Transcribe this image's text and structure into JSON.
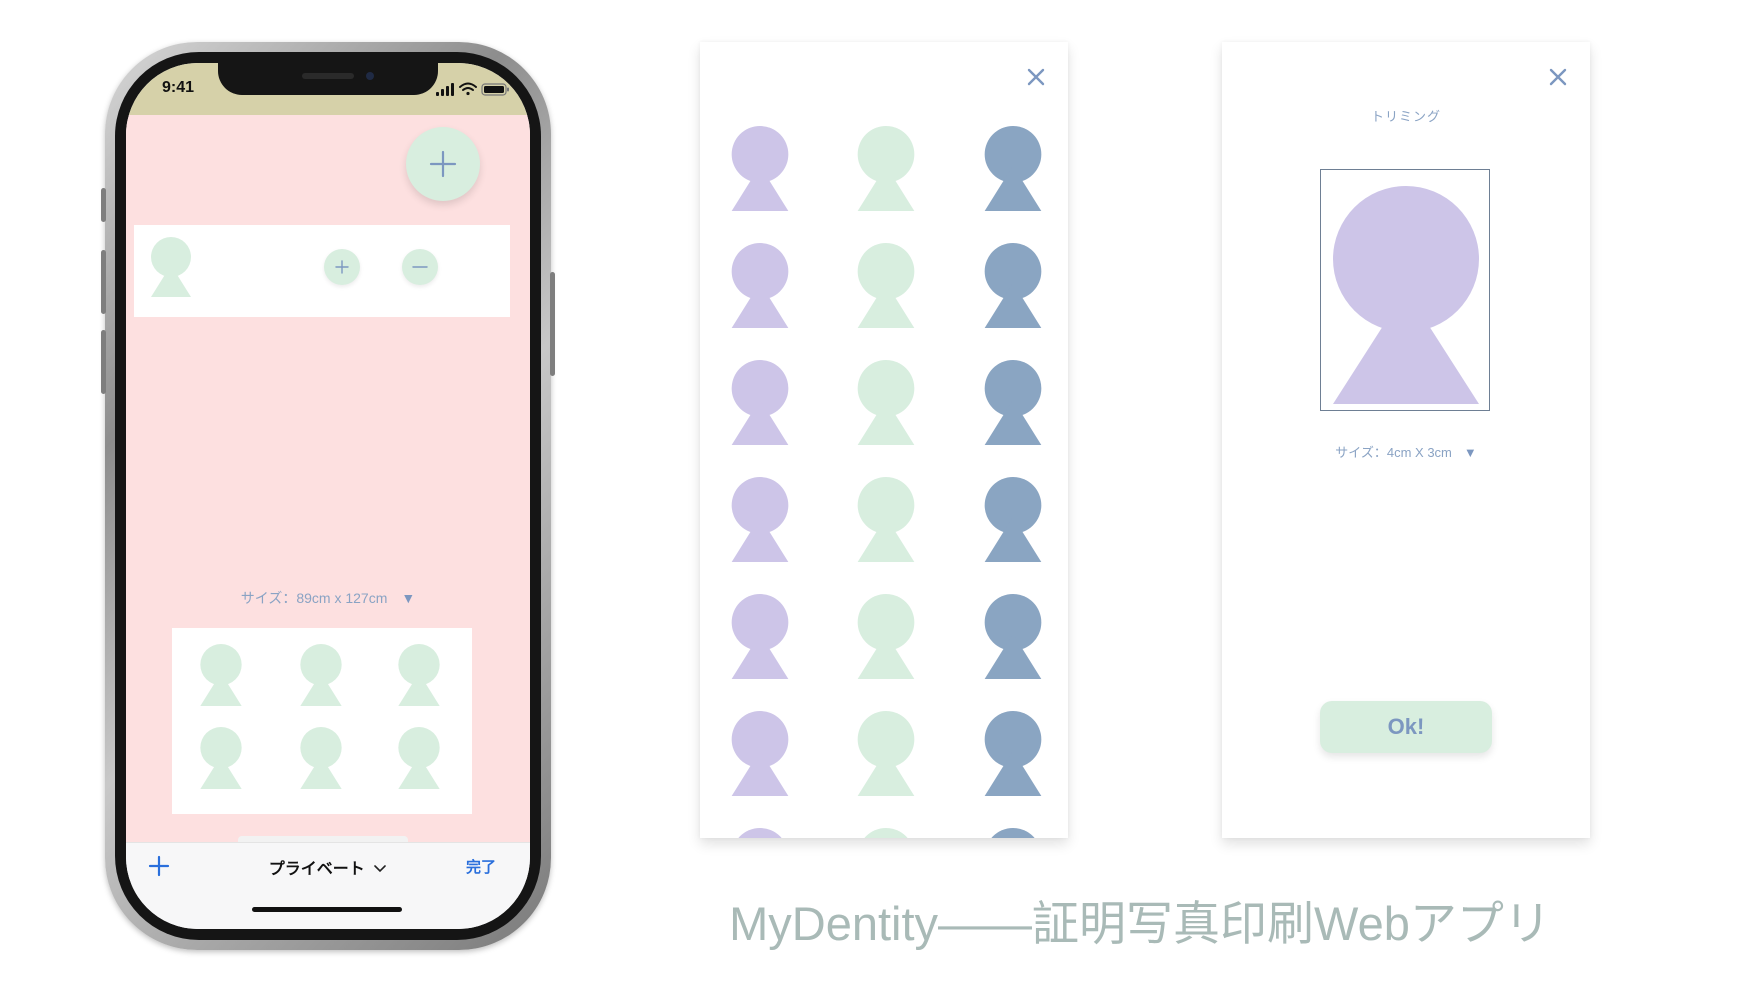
{
  "phone": {
    "status_time": "9:41",
    "order_count": "6",
    "print_size_label": "サイズ：89cm x 127cm",
    "size_dropdown_icon": "▼",
    "tab_bar": {
      "add_icon": "plus-icon",
      "title": "プライベート",
      "title_chevron": "chevron-down-icon",
      "done_label": "完了"
    },
    "preview_photo_count": 6
  },
  "photo_picker": {
    "close_icon": "close-icon",
    "rows_visible": 6,
    "column_colors": [
      "#cdc5e8",
      "#d8eedf",
      "#8aa5c2"
    ]
  },
  "trimming": {
    "close_icon": "close-icon",
    "title": "トリミング",
    "size_label": "サイズ：4cm X 3cm",
    "size_dropdown_icon": "▼",
    "ok_label": "Ok!",
    "figure_color": "#cdc5e8"
  },
  "caption": "MyDentity――証明写真印刷Webアプリ",
  "colors": {
    "pink_background": "#fde0e0",
    "mint": "#d8eedf",
    "lavender": "#cdc5e8",
    "steel_blue": "#8aa5c2",
    "accent_text": "#7c97c0",
    "status_bar": "#d6d1a9",
    "caption_text": "#a9bab7"
  }
}
